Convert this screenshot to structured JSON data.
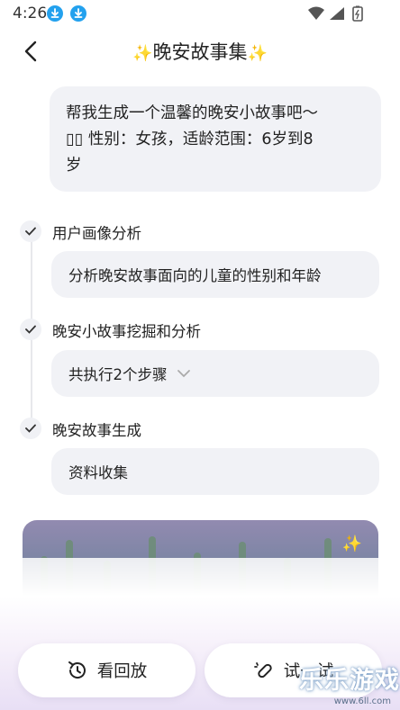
{
  "status_bar": {
    "time": "4:26"
  },
  "header": {
    "title": "晚安故事集",
    "spark_left": "✨",
    "spark_right": "✨"
  },
  "user_message": {
    "line1": "帮我生成一个温馨的晚安小故事吧～",
    "line2": "▯▯ 性别：女孩，适龄范围：6岁到8",
    "line3": "岁"
  },
  "steps": [
    {
      "title": "用户画像分析",
      "detail": "分析晚安故事面向的儿童的性别和年龄"
    },
    {
      "title": "晚安小故事挖掘和分析",
      "detail": "共执行2个步骤"
    },
    {
      "title": "晚安故事生成",
      "detail": "资料收集"
    }
  ],
  "actions": {
    "replay_label": "看回放",
    "try_label": "试一试"
  },
  "watermark": {
    "text": "乐乐游戏",
    "url": "www.6ll.com"
  },
  "colors": {
    "accent_blue": "#23a1ee",
    "sparkle": "#f1b32c",
    "card_bg": "#f1f2f6"
  }
}
